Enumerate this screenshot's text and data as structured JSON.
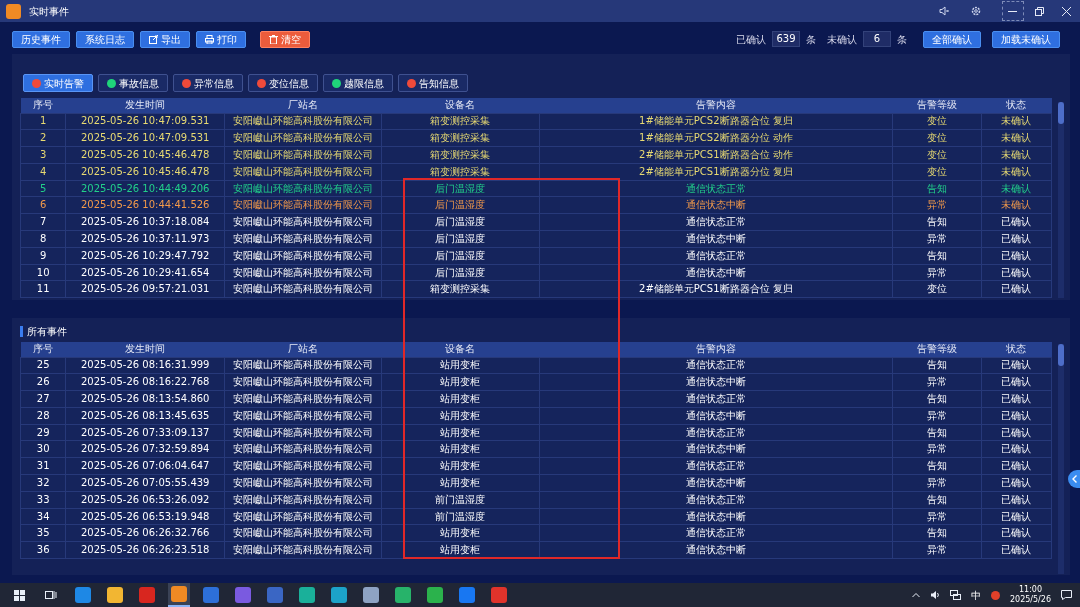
{
  "window": {
    "title": "实时事件"
  },
  "toolbar": {
    "buttons": [
      {
        "label": "历史事件",
        "kind": "plain"
      },
      {
        "label": "系统日志",
        "kind": "plain"
      },
      {
        "label": "导出",
        "kind": "export"
      },
      {
        "label": "打印",
        "kind": "print"
      },
      {
        "label": "清空",
        "kind": "clear"
      }
    ],
    "confirmed_label": "已确认",
    "confirmed": "639",
    "confirmed_unit": "条",
    "unconfirmed_label": "未确认",
    "unconfirmed": "6",
    "unconfirmed_unit": "条",
    "actions": [
      "全部确认",
      "加载未确认"
    ]
  },
  "filters": [
    {
      "label": "实时告警",
      "selected": true,
      "color": "#f04a3a"
    },
    {
      "label": "事故信息",
      "selected": false,
      "color": "#1fd67a"
    },
    {
      "label": "异常信息",
      "selected": false,
      "color": "#f04a3a"
    },
    {
      "label": "变位信息",
      "selected": false,
      "color": "#f04a3a"
    },
    {
      "label": "越限信息",
      "selected": false,
      "color": "#1fd67a"
    },
    {
      "label": "告知信息",
      "selected": false,
      "color": "#f04a3a"
    }
  ],
  "realtime_table": {
    "columns": [
      "序号",
      "发生时间",
      "厂站名",
      "设备名",
      "告警内容",
      "告警等级",
      "状态"
    ],
    "rows": [
      {
        "color": "#e8da72",
        "cells": [
          "1",
          "2025-05-26 10:47:09.531",
          "安阳巘山环能高科股份有限公司",
          "箱变测控采集",
          "1#储能单元PCS2断路器合位 复归",
          "变位",
          "未确认"
        ]
      },
      {
        "color": "#e8da72",
        "cells": [
          "2",
          "2025-05-26 10:47:09.531",
          "安阳巘山环能高科股份有限公司",
          "箱变测控采集",
          "1#储能单元PCS2断路器分位 动作",
          "变位",
          "未确认"
        ]
      },
      {
        "color": "#e8da72",
        "cells": [
          "3",
          "2025-05-26 10:45:46.478",
          "安阳巘山环能高科股份有限公司",
          "箱变测控采集",
          "2#储能单元PCS1断路器合位 动作",
          "变位",
          "未确认"
        ]
      },
      {
        "color": "#e8da72",
        "cells": [
          "4",
          "2025-05-26 10:45:46.478",
          "安阳巘山环能高科股份有限公司",
          "箱变测控采集",
          "2#储能单元PCS1断路器分位 复归",
          "变位",
          "未确认"
        ]
      },
      {
        "color": "#22d08a",
        "cells": [
          "5",
          "2025-05-26 10:44:49.206",
          "安阳巘山环能高科股份有限公司",
          "后门温湿度",
          "通信状态正常",
          "告知",
          "未确认"
        ]
      },
      {
        "color": "#f39a4a",
        "cells": [
          "6",
          "2025-05-26 10:44:41.526",
          "安阳巘山环能高科股份有限公司",
          "后门温湿度",
          "通信状态中断",
          "异常",
          "未确认"
        ]
      },
      {
        "color": "#ffffff",
        "cells": [
          "7",
          "2025-05-26 10:37:18.084",
          "安阳巘山环能高科股份有限公司",
          "后门温湿度",
          "通信状态正常",
          "告知",
          "已确认"
        ]
      },
      {
        "color": "#ffffff",
        "cells": [
          "8",
          "2025-05-26 10:37:11.973",
          "安阳巘山环能高科股份有限公司",
          "后门温湿度",
          "通信状态中断",
          "异常",
          "已确认"
        ]
      },
      {
        "color": "#ffffff",
        "cells": [
          "9",
          "2025-05-26 10:29:47.792",
          "安阳巘山环能高科股份有限公司",
          "后门温湿度",
          "通信状态正常",
          "告知",
          "已确认"
        ]
      },
      {
        "color": "#ffffff",
        "cells": [
          "10",
          "2025-05-26 10:29:41.654",
          "安阳巘山环能高科股份有限公司",
          "后门温湿度",
          "通信状态中断",
          "异常",
          "已确认"
        ]
      },
      {
        "color": "#ffffff",
        "cells": [
          "11",
          "2025-05-26 09:57:21.031",
          "安阳巘山环能高科股份有限公司",
          "箱变测控采集",
          "2#储能单元PCS1断路器合位 复归",
          "变位",
          "已确认"
        ]
      }
    ]
  },
  "all_events": {
    "title": "所有事件",
    "columns": [
      "序号",
      "发生时间",
      "厂站名",
      "设备名",
      "告警内容",
      "告警等级",
      "状态"
    ],
    "rows": [
      [
        "25",
        "2025-05-26 08:16:31.999",
        "安阳巘山环能高科股份有限公司",
        "站用变柜",
        "通信状态正常",
        "告知",
        "已确认"
      ],
      [
        "26",
        "2025-05-26 08:16:22.768",
        "安阳巘山环能高科股份有限公司",
        "站用变柜",
        "通信状态中断",
        "异常",
        "已确认"
      ],
      [
        "27",
        "2025-05-26 08:13:54.860",
        "安阳巘山环能高科股份有限公司",
        "站用变柜",
        "通信状态正常",
        "告知",
        "已确认"
      ],
      [
        "28",
        "2025-05-26 08:13:45.635",
        "安阳巘山环能高科股份有限公司",
        "站用变柜",
        "通信状态中断",
        "异常",
        "已确认"
      ],
      [
        "29",
        "2025-05-26 07:33:09.137",
        "安阳巘山环能高科股份有限公司",
        "站用变柜",
        "通信状态正常",
        "告知",
        "已确认"
      ],
      [
        "30",
        "2025-05-26 07:32:59.894",
        "安阳巘山环能高科股份有限公司",
        "站用变柜",
        "通信状态中断",
        "异常",
        "已确认"
      ],
      [
        "31",
        "2025-05-26 07:06:04.647",
        "安阳巘山环能高科股份有限公司",
        "站用变柜",
        "通信状态正常",
        "告知",
        "已确认"
      ],
      [
        "32",
        "2025-05-26 07:05:55.439",
        "安阳巘山环能高科股份有限公司",
        "站用变柜",
        "通信状态中断",
        "异常",
        "已确认"
      ],
      [
        "33",
        "2025-05-26 06:53:26.092",
        "安阳巘山环能高科股份有限公司",
        "前门温湿度",
        "通信状态正常",
        "告知",
        "已确认"
      ],
      [
        "34",
        "2025-05-26 06:53:19.948",
        "安阳巘山环能高科股份有限公司",
        "前门温湿度",
        "通信状态中断",
        "异常",
        "已确认"
      ],
      [
        "35",
        "2025-05-26 06:26:32.766",
        "安阳巘山环能高科股份有限公司",
        "站用变柜",
        "通信状态正常",
        "告知",
        "已确认"
      ],
      [
        "36",
        "2025-05-26 06:26:23.518",
        "安阳巘山环能高科股份有限公司",
        "站用变柜",
        "通信状态中断",
        "异常",
        "已确认"
      ]
    ]
  },
  "taskbar": {
    "apps": [
      {
        "color": "#1e88e5",
        "selected": false
      },
      {
        "color": "#f2b632",
        "selected": false
      },
      {
        "color": "#d8261f",
        "selected": false
      },
      {
        "color": "#f08a24",
        "selected": true
      },
      {
        "color": "#2d6fd8",
        "selected": false
      },
      {
        "color": "#7a5ae0",
        "selected": false
      },
      {
        "color": "#3a66c4",
        "selected": false
      },
      {
        "color": "#1ab09a",
        "selected": false
      },
      {
        "color": "#1ca3c9",
        "selected": false
      },
      {
        "color": "#8ea3c4",
        "selected": false
      },
      {
        "color": "#27b36a",
        "selected": false
      },
      {
        "color": "#2bb24c",
        "selected": false
      },
      {
        "color": "#1877f2",
        "selected": false
      },
      {
        "color": "#e0332b",
        "selected": false
      }
    ],
    "ime": "中",
    "time": "11:00",
    "date": "2025/5/26"
  }
}
